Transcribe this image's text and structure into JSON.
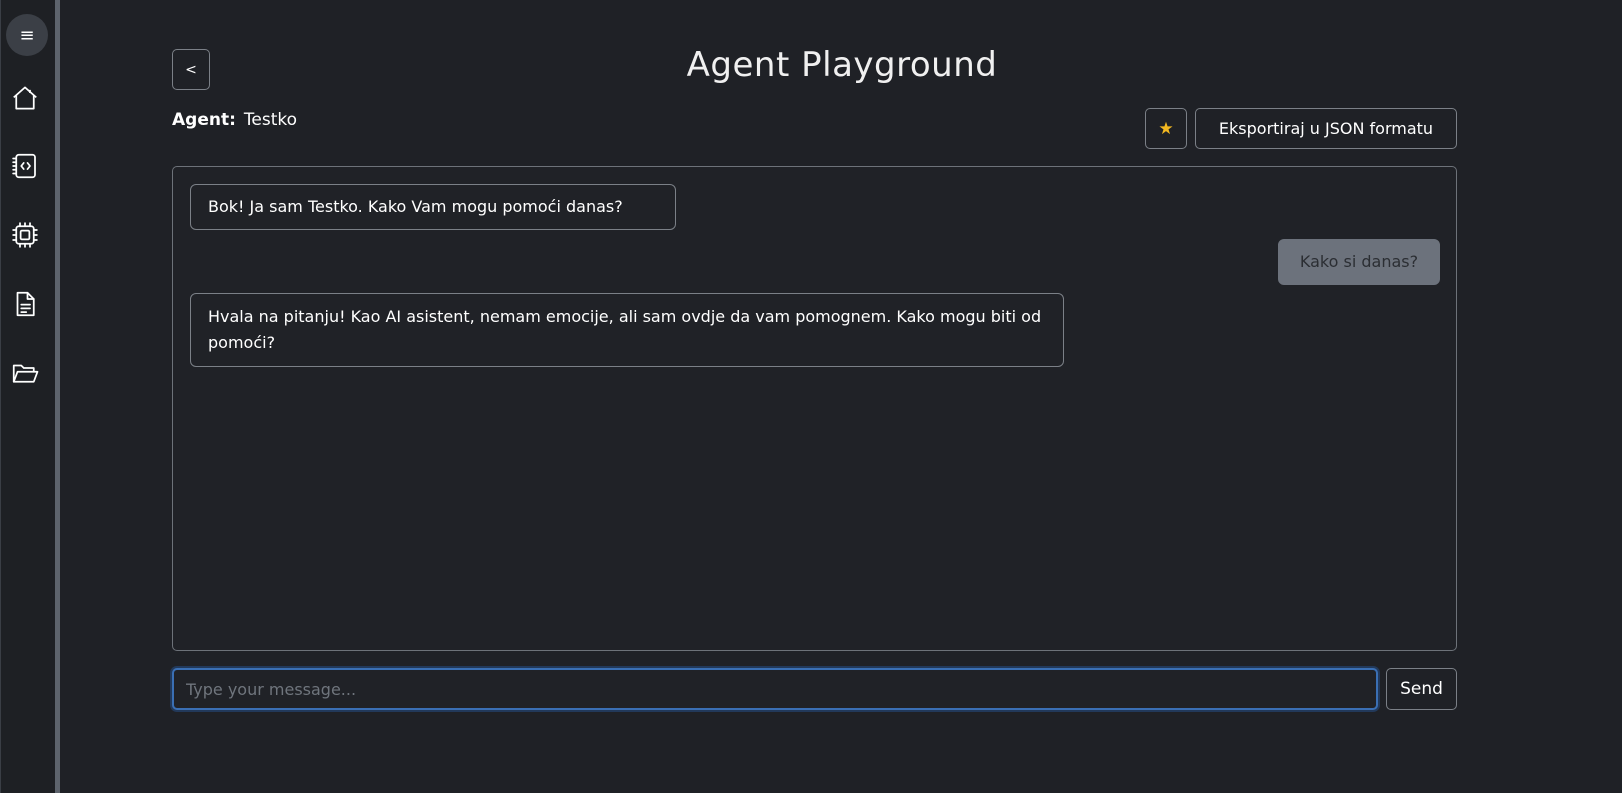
{
  "sidebar": {
    "menu_icon": "≡",
    "items": [
      {
        "name": "home",
        "icon": "home-icon"
      },
      {
        "name": "code",
        "icon": "code-file-icon"
      },
      {
        "name": "chip",
        "icon": "chip-icon"
      },
      {
        "name": "document",
        "icon": "document-icon"
      },
      {
        "name": "folder",
        "icon": "folder-icon"
      }
    ]
  },
  "header": {
    "back_label": "<",
    "title": "Agent Playground"
  },
  "agent": {
    "key": "Agent:",
    "name": "Testko"
  },
  "toolbar": {
    "star_label": "★",
    "export_label": "Eksportiraj u JSON formatu"
  },
  "chat": {
    "messages": [
      {
        "role": "assistant",
        "text": "Bok! Ja sam Testko. Kako Vam mogu pomoći danas?"
      },
      {
        "role": "user",
        "text": "Kako si danas?"
      },
      {
        "role": "assistant",
        "text": "Hvala na pitanju! Kao AI asistent, nemam emocije, ali sam ovdje da vam pomognem. Kako mogu biti od pomoći?"
      }
    ]
  },
  "composer": {
    "value": "",
    "placeholder": "Type your message...",
    "send_label": "Send"
  },
  "colors": {
    "background": "#1f2126",
    "accent_focus": "#3a6fb4",
    "star": "#f2b820",
    "user_bubble": "#6c727c"
  }
}
